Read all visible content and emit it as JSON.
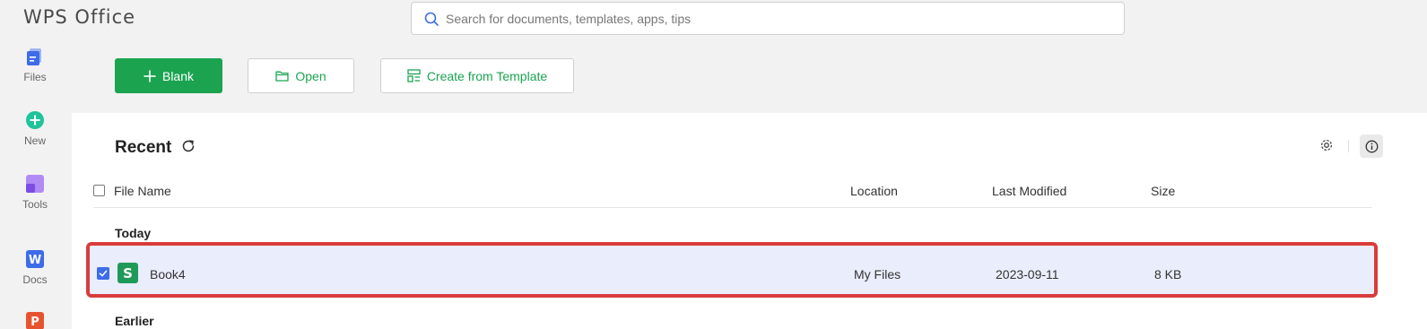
{
  "app": {
    "title": "WPS Office"
  },
  "search": {
    "placeholder": "Search for documents, templates, apps, tips",
    "value": ""
  },
  "sidebar": {
    "items": [
      {
        "label": "Files",
        "icon": "files-icon"
      },
      {
        "label": "New",
        "icon": "new-icon"
      },
      {
        "label": "Tools",
        "icon": "tools-icon"
      },
      {
        "label": "Docs",
        "icon": "docs-icon"
      },
      {
        "label": "",
        "icon": "presentation-icon"
      }
    ]
  },
  "toolbar": {
    "blank_label": "Blank",
    "open_label": "Open",
    "template_label": "Create from Template"
  },
  "recent": {
    "title": "Recent",
    "columns": {
      "name": "File Name",
      "location": "Location",
      "modified": "Last Modified",
      "size": "Size"
    },
    "groups": {
      "today": "Today",
      "earlier": "Earlier"
    },
    "files": [
      {
        "icon_letter": "S",
        "name": "Book4",
        "location": "My Files",
        "modified": "2023-09-11",
        "size": "8 KB",
        "selected": true
      }
    ]
  },
  "colors": {
    "accent": "#1ba350",
    "selection": "#eaedfb",
    "highlight_border": "#d93c3c",
    "checkbox": "#3d6bea",
    "sheet_icon": "#1e9a58"
  }
}
